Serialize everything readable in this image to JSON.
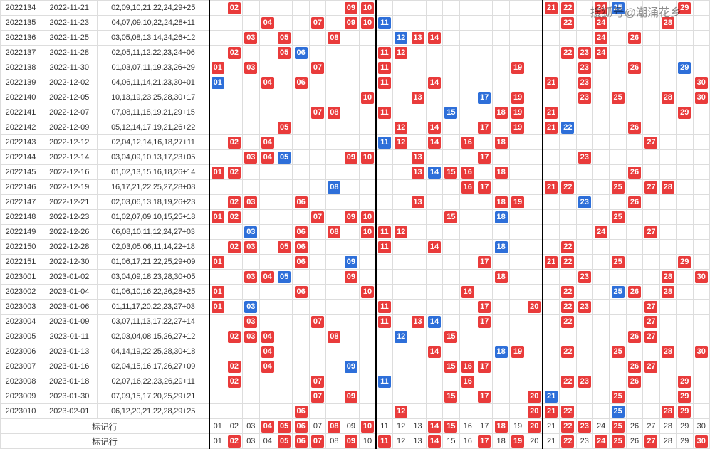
{
  "watermark": "搜狐号@潮涌花乡",
  "summary_label": "标记行",
  "rows": [
    {
      "period": "2022134",
      "date": "2022-11-21",
      "nums": "02,09,10,21,22,24,29+25",
      "red": [
        2,
        9,
        10,
        21,
        22,
        24,
        29
      ],
      "blue": [
        25
      ]
    },
    {
      "period": "2022135",
      "date": "2022-11-23",
      "nums": "04,07,09,10,22,24,28+11",
      "red": [
        4,
        7,
        9,
        10,
        22,
        24,
        28
      ],
      "blue": [
        11
      ]
    },
    {
      "period": "2022136",
      "date": "2022-11-25",
      "nums": "03,05,08,13,14,24,26+12",
      "red": [
        3,
        5,
        8,
        13,
        14,
        24,
        26
      ],
      "blue": [
        12
      ]
    },
    {
      "period": "2022137",
      "date": "2022-11-28",
      "nums": "02,05,11,12,22,23,24+06",
      "red": [
        2,
        5,
        11,
        12,
        22,
        23,
        24
      ],
      "blue": [
        6
      ]
    },
    {
      "period": "2022138",
      "date": "2022-11-30",
      "nums": "01,03,07,11,19,23,26+29",
      "red": [
        1,
        3,
        7,
        11,
        19,
        23,
        26
      ],
      "blue": [
        29
      ]
    },
    {
      "period": "2022139",
      "date": "2022-12-02",
      "nums": "04,06,11,14,21,23,30+01",
      "red": [
        4,
        6,
        11,
        14,
        21,
        23,
        30
      ],
      "blue": [
        1
      ]
    },
    {
      "period": "2022140",
      "date": "2022-12-05",
      "nums": "10,13,19,23,25,28,30+17",
      "red": [
        10,
        13,
        19,
        23,
        25,
        28,
        30
      ],
      "blue": [
        17
      ]
    },
    {
      "period": "2022141",
      "date": "2022-12-07",
      "nums": "07,08,11,18,19,21,29+15",
      "red": [
        7,
        8,
        11,
        18,
        19,
        21,
        29
      ],
      "blue": [
        15
      ]
    },
    {
      "period": "2022142",
      "date": "2022-12-09",
      "nums": "05,12,14,17,19,21,26+22",
      "red": [
        5,
        12,
        14,
        17,
        19,
        21,
        26
      ],
      "blue": [
        22
      ]
    },
    {
      "period": "2022143",
      "date": "2022-12-12",
      "nums": "02,04,12,14,16,18,27+11",
      "red": [
        2,
        4,
        12,
        14,
        16,
        18,
        27
      ],
      "blue": [
        11
      ]
    },
    {
      "period": "2022144",
      "date": "2022-12-14",
      "nums": "03,04,09,10,13,17,23+05",
      "red": [
        3,
        4,
        9,
        10,
        13,
        17,
        23
      ],
      "blue": [
        5
      ]
    },
    {
      "period": "2022145",
      "date": "2022-12-16",
      "nums": "01,02,13,15,16,18,26+14",
      "red": [
        1,
        2,
        13,
        15,
        16,
        18,
        26
      ],
      "blue": [
        14
      ]
    },
    {
      "period": "2022146",
      "date": "2022-12-19",
      "nums": "16,17,21,22,25,27,28+08",
      "red": [
        16,
        17,
        21,
        22,
        25,
        27,
        28
      ],
      "blue": [
        8
      ]
    },
    {
      "period": "2022147",
      "date": "2022-12-21",
      "nums": "02,03,06,13,18,19,26+23",
      "red": [
        2,
        3,
        6,
        13,
        18,
        19,
        26
      ],
      "blue": [
        23
      ]
    },
    {
      "period": "2022148",
      "date": "2022-12-23",
      "nums": "01,02,07,09,10,15,25+18",
      "red": [
        1,
        2,
        7,
        9,
        10,
        15,
        25
      ],
      "blue": [
        18
      ]
    },
    {
      "period": "2022149",
      "date": "2022-12-26",
      "nums": "06,08,10,11,12,24,27+03",
      "red": [
        6,
        8,
        10,
        11,
        12,
        24,
        27
      ],
      "blue": [
        3
      ]
    },
    {
      "period": "2022150",
      "date": "2022-12-28",
      "nums": "02,03,05,06,11,14,22+18",
      "red": [
        2,
        3,
        5,
        6,
        11,
        14,
        22
      ],
      "blue": [
        18
      ]
    },
    {
      "period": "2022151",
      "date": "2022-12-30",
      "nums": "01,06,17,21,22,25,29+09",
      "red": [
        1,
        6,
        17,
        21,
        22,
        25,
        29
      ],
      "blue": [
        9
      ]
    },
    {
      "period": "2023001",
      "date": "2023-01-02",
      "nums": "03,04,09,18,23,28,30+05",
      "red": [
        3,
        4,
        9,
        18,
        23,
        28,
        30
      ],
      "blue": [
        5
      ]
    },
    {
      "period": "2023002",
      "date": "2023-01-04",
      "nums": "01,06,10,16,22,26,28+25",
      "red": [
        1,
        6,
        10,
        16,
        22,
        26,
        28
      ],
      "blue": [
        25
      ]
    },
    {
      "period": "2023003",
      "date": "2023-01-06",
      "nums": "01,11,17,20,22,23,27+03",
      "red": [
        1,
        11,
        17,
        20,
        22,
        23,
        27
      ],
      "blue": [
        3
      ]
    },
    {
      "period": "2023004",
      "date": "2023-01-09",
      "nums": "03,07,11,13,17,22,27+14",
      "red": [
        3,
        7,
        11,
        13,
        17,
        22,
        27
      ],
      "blue": [
        14
      ]
    },
    {
      "period": "2023005",
      "date": "2023-01-11",
      "nums": "02,03,04,08,15,26,27+12",
      "red": [
        2,
        3,
        4,
        8,
        15,
        26,
        27
      ],
      "blue": [
        12
      ]
    },
    {
      "period": "2023006",
      "date": "2023-01-13",
      "nums": "04,14,19,22,25,28,30+18",
      "red": [
        4,
        14,
        19,
        22,
        25,
        28,
        30
      ],
      "blue": [
        18
      ]
    },
    {
      "period": "2023007",
      "date": "2023-01-16",
      "nums": "02,04,15,16,17,26,27+09",
      "red": [
        2,
        4,
        15,
        16,
        17,
        26,
        27
      ],
      "blue": [
        9
      ]
    },
    {
      "period": "2023008",
      "date": "2023-01-18",
      "nums": "02,07,16,22,23,26,29+11",
      "red": [
        2,
        7,
        16,
        22,
        23,
        26,
        29
      ],
      "blue": [
        11
      ]
    },
    {
      "period": "2023009",
      "date": "2023-01-30",
      "nums": "07,09,15,17,20,25,29+21",
      "red": [
        7,
        9,
        15,
        17,
        20,
        25,
        29
      ],
      "blue": [
        21
      ]
    },
    {
      "period": "2023010",
      "date": "2023-02-01",
      "nums": "06,12,20,21,22,28,29+25",
      "red": [
        6,
        12,
        20,
        21,
        22,
        28,
        29
      ],
      "blue": [
        25
      ]
    }
  ],
  "summary1": {
    "red": [
      4,
      5,
      6,
      8,
      10,
      14,
      15,
      18,
      20,
      22,
      23,
      25
    ],
    "blue": [],
    "text": [
      1,
      2,
      3,
      7,
      9,
      11,
      12,
      13,
      16,
      17,
      19,
      21,
      24,
      26,
      27,
      28,
      29,
      30
    ]
  },
  "summary2": {
    "red": [
      2,
      5,
      6,
      7,
      9,
      11,
      14,
      17,
      19,
      22,
      24,
      25,
      27,
      30
    ],
    "blue": [],
    "text": [
      1,
      3,
      4,
      8,
      10,
      12,
      13,
      15,
      16,
      18,
      20,
      21,
      23,
      26,
      28,
      29
    ]
  }
}
